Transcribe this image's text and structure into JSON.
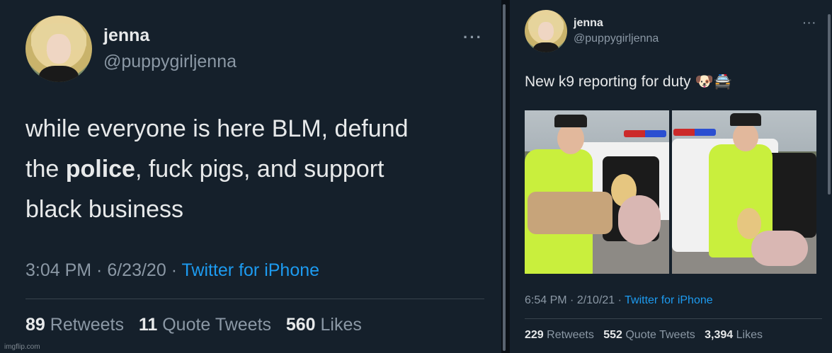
{
  "left_tweet": {
    "name": "jenna",
    "handle": "@puppygirljenna",
    "more": "···",
    "text_line1": "while everyone is here BLM, defund",
    "text_line2_pre": "the ",
    "text_line2_bold": "police",
    "text_line2_post": ", fuck pigs, and support",
    "text_line3": "black business",
    "time": "3:04 PM",
    "date": "6/23/20",
    "source": "Twitter for iPhone",
    "retweets_count": "89",
    "retweets_label": "Retweets",
    "quotes_count": "11",
    "quotes_label": "Quote Tweets",
    "likes_count": "560",
    "likes_label": "Likes"
  },
  "right_tweet": {
    "name": "jenna",
    "handle": "@puppygirljenna",
    "more": "···",
    "text": "New k9 reporting for duty 🐶🚔",
    "time": "6:54 PM",
    "date": "2/10/21",
    "source": "Twitter for iPhone",
    "retweets_count": "229",
    "retweets_label": "Retweets",
    "quotes_count": "552",
    "quotes_label": "Quote Tweets",
    "likes_count": "3,394",
    "likes_label": "Likes"
  },
  "watermark": "imgflip.com",
  "colors": {
    "background": "#15202b",
    "link": "#1d9bf0",
    "secondary_text": "#8b98a5",
    "primary_text": "#e7e9ea"
  }
}
